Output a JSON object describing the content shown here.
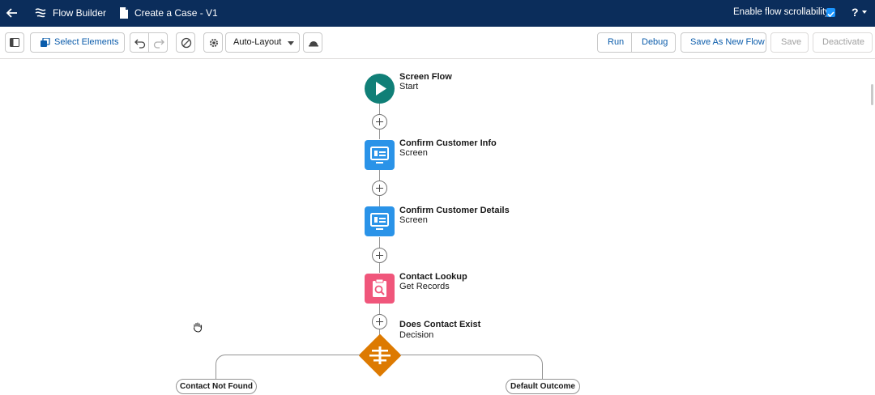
{
  "header": {
    "app_title": "Flow Builder",
    "flow_name": "Create a Case - V1",
    "scroll_toggle_label": "Enable flow scrollability",
    "scroll_toggle_checked": true,
    "help_label": "?"
  },
  "toolbar": {
    "select_elements_label": "Select Elements",
    "layout_mode": "Auto-Layout",
    "run_label": "Run",
    "debug_label": "Debug",
    "save_as_new_label": "Save As New Flow",
    "save_label": "Save",
    "deactivate_label": "Deactivate"
  },
  "flow": {
    "start": {
      "title": "Screen Flow",
      "subtitle": "Start",
      "color": "#107f77"
    },
    "nodes": [
      {
        "title": "Confirm Customer Info",
        "subtitle": "Screen",
        "icon": "screen-icon",
        "color": "#2a93e8"
      },
      {
        "title": "Confirm Customer Details",
        "subtitle": "Screen",
        "icon": "screen-icon",
        "color": "#2a93e8"
      },
      {
        "title": "Contact Lookup",
        "subtitle": "Get Records",
        "icon": "get-records-icon",
        "color": "#f0567b"
      }
    ],
    "decision": {
      "title": "Does Contact Exist",
      "subtitle": "Decision",
      "color": "#dd7a01"
    },
    "outcomes": [
      "Contact Not Found",
      "Default Outcome"
    ]
  },
  "colors": {
    "header_bg": "#0b2d5b",
    "accent": "#0b5cab",
    "checkbox": "#1b96ff"
  }
}
